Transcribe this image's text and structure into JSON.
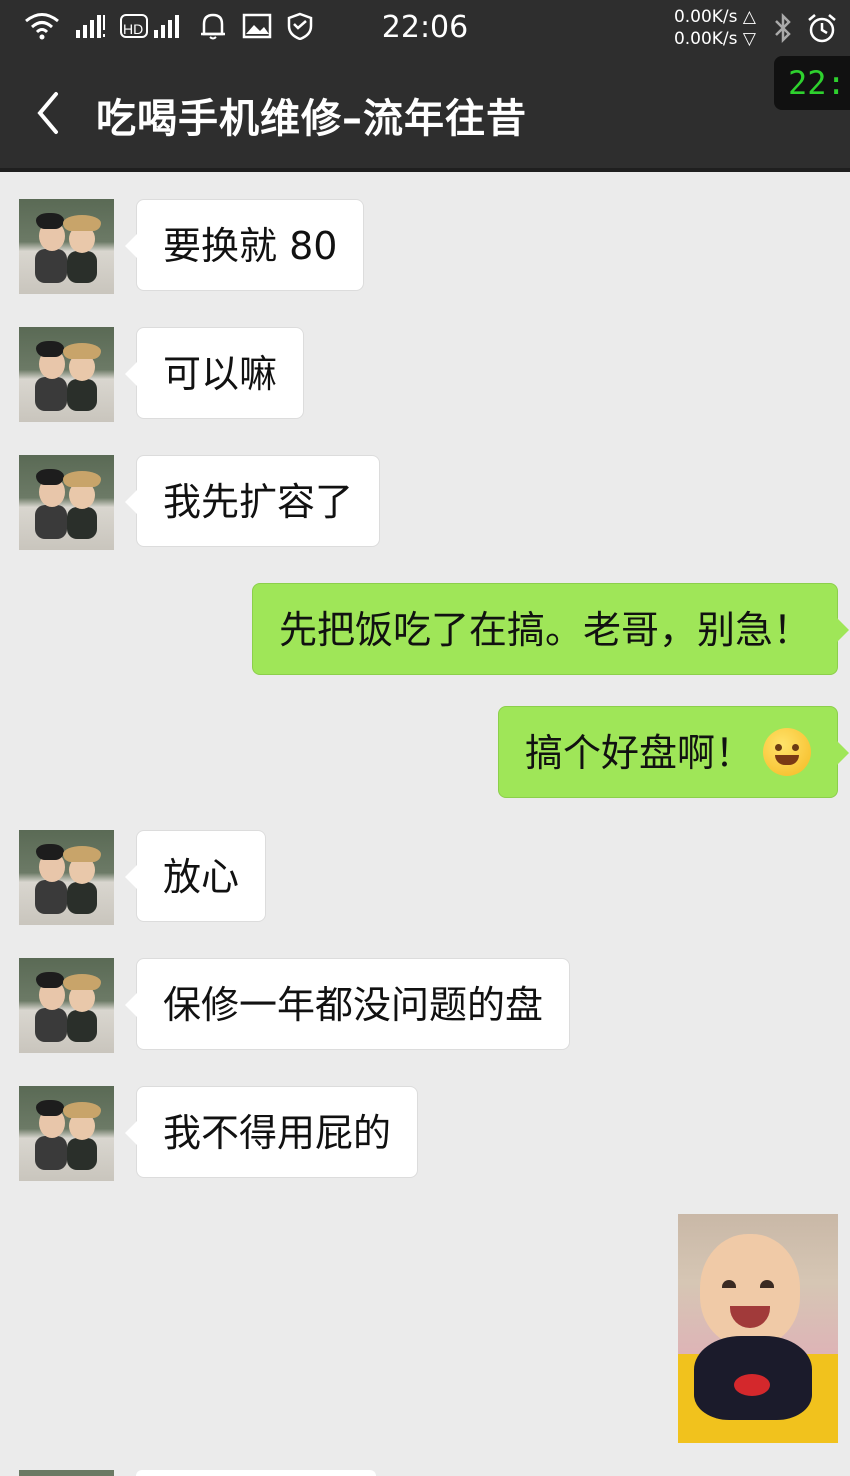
{
  "status_bar": {
    "time": "22:06",
    "net_up": "0.00K/s △",
    "net_down": "0.00K/s ▽",
    "icons": [
      "wifi-icon",
      "signal-icon",
      "hd-signal-icon",
      "notification-icon",
      "image-icon",
      "shield-icon",
      "bluetooth-icon",
      "alarm-icon"
    ]
  },
  "header": {
    "title": "吃喝手机维修–流年往昔",
    "floating_clock": "22:"
  },
  "messages": [
    {
      "side": "in",
      "text": "要换就 80"
    },
    {
      "side": "in",
      "text": "可以嘛"
    },
    {
      "side": "in",
      "text": "我先扩容了"
    },
    {
      "side": "out",
      "text": "先把饭吃了在搞。老哥，别急！"
    },
    {
      "side": "out",
      "text": "搞个好盘啊！",
      "emoji": "grinning-face-icon"
    },
    {
      "side": "in",
      "text": "放心"
    },
    {
      "side": "in",
      "text": "保修一年都没问题的盘"
    },
    {
      "side": "in",
      "text": "我不得用屁的"
    },
    {
      "side": "out",
      "type": "image",
      "image": "baby-photo"
    }
  ],
  "colors": {
    "bar_bg": "#2e2e2e",
    "chat_bg": "#ebebeb",
    "out_bubble": "#9fe658",
    "in_bubble": "#ffffff",
    "clock_green": "#2ed12e"
  }
}
